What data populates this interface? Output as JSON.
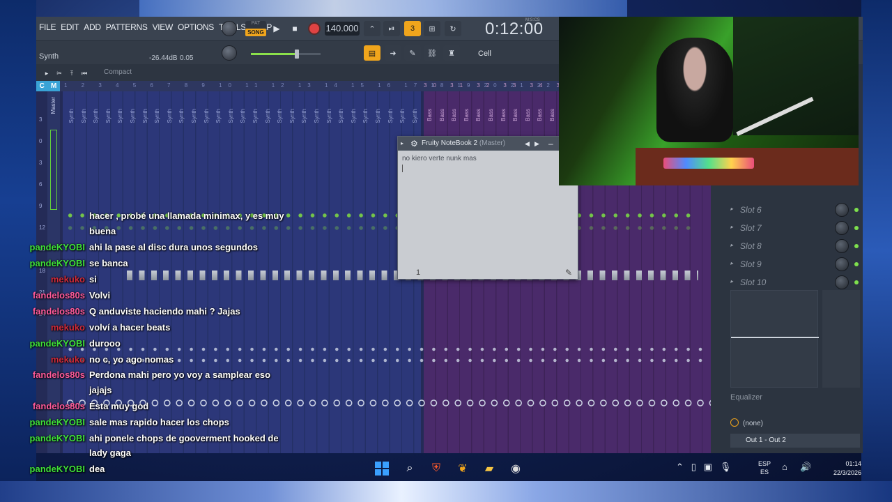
{
  "menu": [
    "FILE",
    "EDIT",
    "ADD",
    "PATTERNS",
    "VIEW",
    "OPTIONS",
    "TOOLS",
    "HELP"
  ],
  "transport": {
    "pat_label": "PAT",
    "song_label": "SONG",
    "bpm": "140.000",
    "time": "0:12:00",
    "time_unit": "M:S:CS"
  },
  "channel": {
    "hint": "Synth",
    "volume_db": "-26.44dB",
    "volume_value": "0.05",
    "slider_level": 0.66
  },
  "snap": {
    "value": "Cell"
  },
  "mixer": {
    "view_label": "Compact",
    "ruler_cm": [
      "C",
      "M"
    ],
    "ruler_blue": "1 2 3 4 5 6 7 8 9 10 11 12 13 14 15 16 17 18 19 20 21 22 23 24 25 26 27 28 29",
    "ruler_pink": "30 31 32 33 34 35 36 37 38 39 40",
    "master_label": "Master",
    "scale": [
      "3",
      "0",
      "3",
      "6",
      "9",
      "12",
      "15",
      "18",
      "21",
      "24"
    ],
    "strip_name_blue": "Synth",
    "strip_name_pink": "Bass"
  },
  "slots": [
    {
      "label": "Slot 6"
    },
    {
      "label": "Slot 7"
    },
    {
      "label": "Slot 8"
    },
    {
      "label": "Slot 9"
    },
    {
      "label": "Slot 10"
    }
  ],
  "equalizer": {
    "label": "Equalizer",
    "preset": "(none)",
    "output": "Out 1 - Out 2"
  },
  "notebook": {
    "title": "Fruity NoteBook 2",
    "target": "(Master)",
    "text": "no kiero verte nunk mas",
    "page": "1"
  },
  "chat": [
    {
      "user": "",
      "text": "hacer , probé una llamada minimax, y es muy",
      "color": "green"
    },
    {
      "user": "",
      "text": "buena",
      "color": "green"
    },
    {
      "user": "pandeKYOBI",
      "text": "ahi la pase al disc dura unos segundos",
      "color": "green"
    },
    {
      "user": "pandeKYOBI",
      "text": "se banca",
      "color": "green"
    },
    {
      "user": "mekuko",
      "text": "si",
      "color": "red"
    },
    {
      "user": "fandelos80s",
      "text": "Volvi",
      "color": "pink"
    },
    {
      "user": "fandelos80s",
      "text": "Q anduviste haciendo mahi ? Jajas",
      "color": "pink"
    },
    {
      "user": "mekuko",
      "text": "volví a hacer beats",
      "color": "red"
    },
    {
      "user": "pandeKYOBI",
      "text": "durooo",
      "color": "green"
    },
    {
      "user": "mekuko",
      "text": "no c, yo ago nomas",
      "color": "red"
    },
    {
      "user": "fandelos80s",
      "text": "Perdona mahi pero yo voy a samplear eso",
      "color": "pink"
    },
    {
      "user": "",
      "text": "jajajs",
      "color": "pink"
    },
    {
      "user": "fandelos80s",
      "text": "Esta muy god",
      "color": "pink"
    },
    {
      "user": "pandeKYOBI",
      "text": "sale mas rapido hacer los chops",
      "color": "green"
    },
    {
      "user": "pandeKYOBI",
      "text": "ahi ponele chops de gooverment hooked de",
      "color": "green"
    },
    {
      "user": "",
      "text": "lady gaga",
      "color": "green"
    },
    {
      "user": "pandeKYOBI",
      "text": "dea",
      "color": "green"
    }
  ],
  "taskbar": {
    "lang_top": "ESP",
    "lang_bottom": "ES",
    "time": "01:14",
    "date": "22/3/2026",
    "icons": [
      "windows-icon",
      "search-icon",
      "brave-icon",
      "fl-studio-icon",
      "file-explorer-icon",
      "obs-icon"
    ]
  },
  "colors": {
    "accent": "#f0a51c",
    "green": "#3fe03a",
    "pink": "#ff5b9c",
    "mixer_blue": "#2c3779",
    "mixer_pink": "#4a2a6a"
  }
}
